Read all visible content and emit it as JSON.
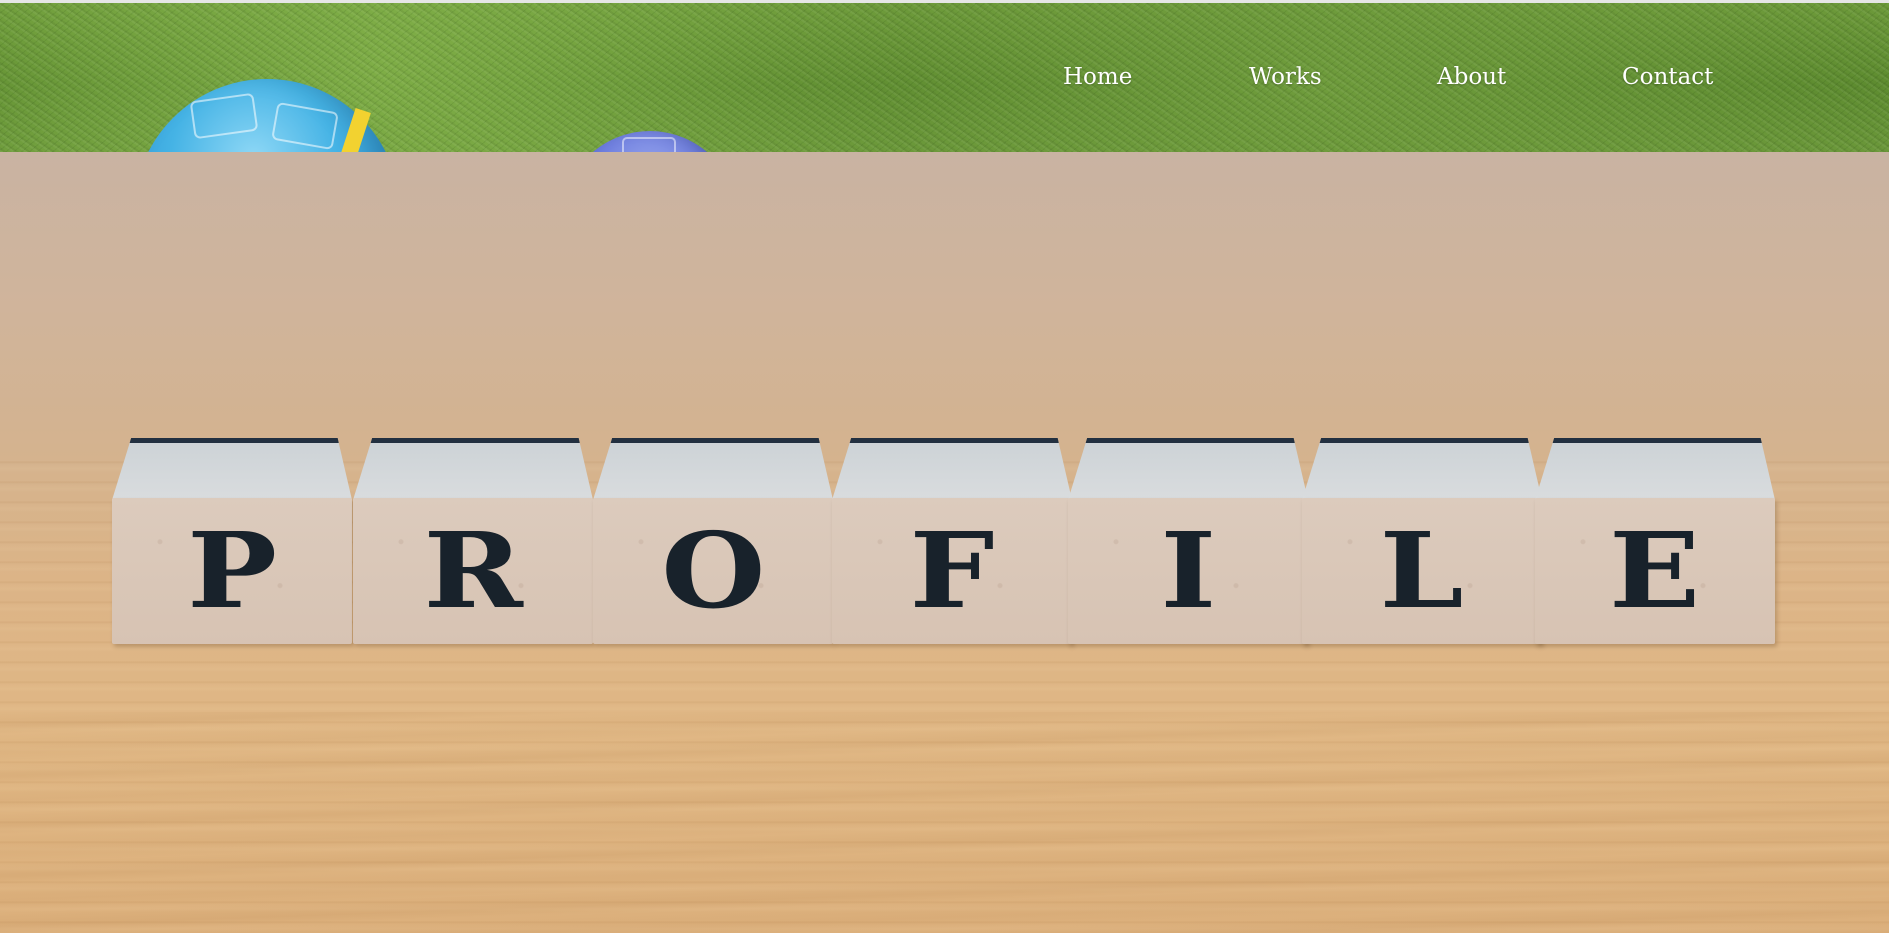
{
  "nav": {
    "items": [
      {
        "label": "Home"
      },
      {
        "label": "Works"
      },
      {
        "label": "About"
      },
      {
        "label": "Contact"
      }
    ]
  },
  "hero": {
    "block_letters": [
      "P",
      "R",
      "O",
      "F",
      "I",
      "L",
      "E"
    ]
  },
  "colors": {
    "nav_text": "#ffffff",
    "grass": "#5e8c30",
    "wood": "#dcb487",
    "letter": "#18222b"
  }
}
